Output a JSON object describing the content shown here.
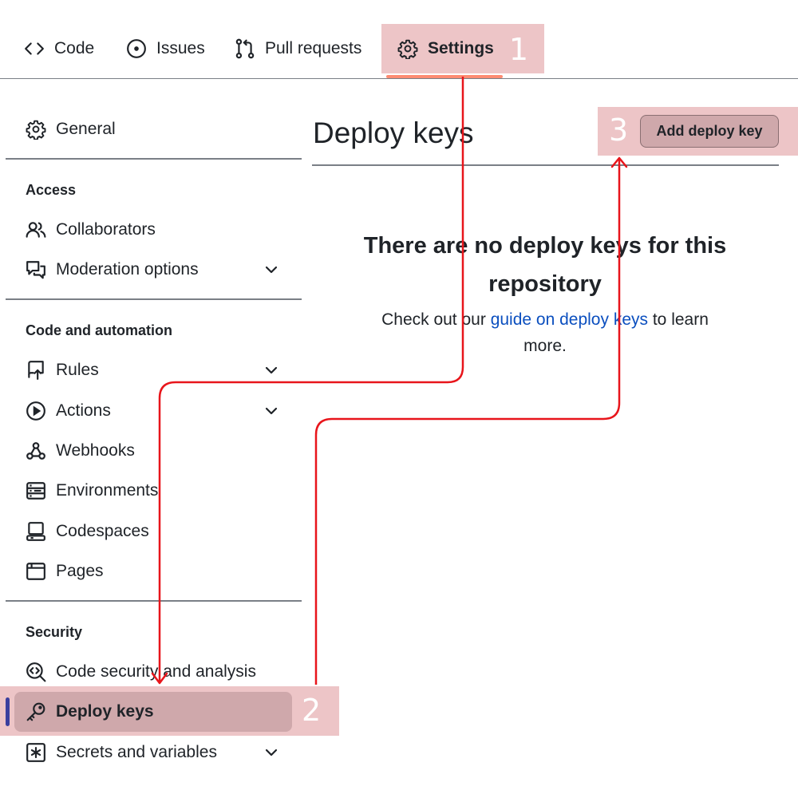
{
  "nav": {
    "tabs": [
      {
        "label": "Code",
        "icon": "code-icon"
      },
      {
        "label": "Issues",
        "icon": "issue-opened-icon"
      },
      {
        "label": "Pull requests",
        "icon": "git-pull-request-icon"
      },
      {
        "label": "Settings",
        "icon": "gear-icon",
        "selected": true
      }
    ]
  },
  "sidebar": {
    "general": "General",
    "sections": [
      {
        "heading": "Access",
        "items": [
          "Collaborators",
          "Moderation options"
        ]
      },
      {
        "heading": "Code and automation",
        "items": [
          "Rules",
          "Actions",
          "Webhooks",
          "Environments",
          "Codespaces",
          "Pages"
        ]
      },
      {
        "heading": "Security",
        "items": [
          "Code security and analysis",
          "Deploy keys",
          "Secrets and variables"
        ]
      }
    ],
    "selected_item": "Deploy keys"
  },
  "main": {
    "title": "Deploy keys",
    "add_button": "Add deploy key",
    "empty_title": "There are no deploy keys for this repository",
    "empty_prefix": "Check out our",
    "empty_link": "guide on deploy keys",
    "empty_suffix": "to learn more."
  },
  "callouts": [
    "1",
    "2",
    "3"
  ],
  "colors": {
    "highlight": "#edc5c7",
    "selected_fill": "#cfa8ab",
    "arrow": "#e8151b",
    "link": "#0b4fbf",
    "selected_bar": "#3b3f9e"
  }
}
